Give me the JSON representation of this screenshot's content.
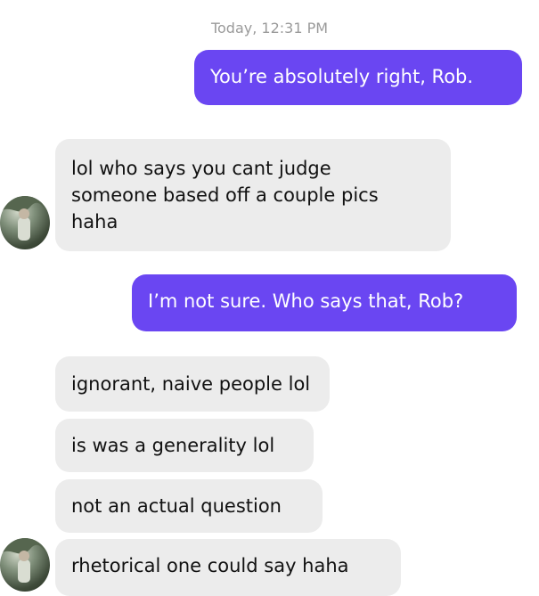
{
  "conversation": {
    "timestamp": "Today, 12:31 PM",
    "messages": [
      {
        "direction": "outgoing",
        "text": "You’re absolutely right, Rob."
      },
      {
        "direction": "incoming",
        "lines": [
          "lol who says you cant judge",
          "someone based off a couple pics",
          "haha"
        ]
      },
      {
        "direction": "outgoing",
        "text": "I’m not sure. Who says that, Rob?"
      },
      {
        "direction": "incoming",
        "text": "ignorant, naive people lol"
      },
      {
        "direction": "incoming",
        "text": "is was a generality lol"
      },
      {
        "direction": "incoming",
        "text": "not an actual question"
      },
      {
        "direction": "incoming",
        "text": "rhetorical one could say haha"
      }
    ]
  },
  "colors": {
    "outgoing_bubble": "#6a46f2",
    "incoming_bubble": "#ececec",
    "timestamp_text": "#9a9a9a"
  },
  "icons": [
    "contact-avatar"
  ]
}
